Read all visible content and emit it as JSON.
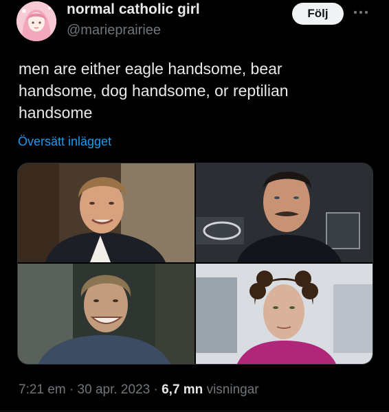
{
  "author": {
    "display_name": "normal catholic girl",
    "handle": "@marieprairiee"
  },
  "actions": {
    "follow_label": "Följ",
    "more_icon": "more-horizontal-icon"
  },
  "tweet": {
    "text": "men are either eagle handsome, bear\nhandsome, dog handsome, or reptilian\nhandsome",
    "translate_label": "Översätt inlägget"
  },
  "media": {
    "photo_count": 4
  },
  "meta": {
    "time": "7:21 em",
    "separator": "·",
    "date": "30 apr. 2023",
    "views_count": "6,7 mn",
    "views_label": "visningar"
  },
  "colors": {
    "background": "#000000",
    "text_primary": "#e7e9ea",
    "text_secondary": "#71767b",
    "link": "#1d9bf0",
    "follow_bg": "#eff3f4"
  }
}
